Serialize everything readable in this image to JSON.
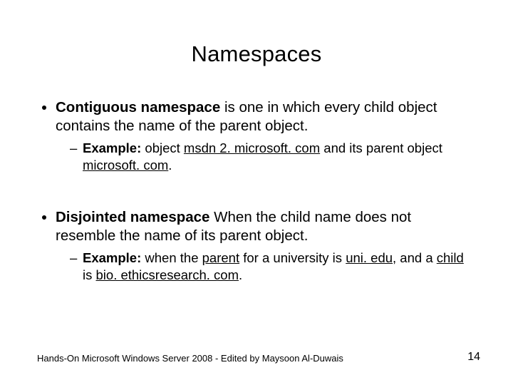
{
  "title": "Namespaces",
  "topic1": {
    "label": "Contiguous namespace",
    "rest": " is one in which every child object contains the name of the parent object.",
    "example_label": "Example:",
    "example_prefix": "   object ",
    "example_link1": "msdn 2. microsoft. com",
    "example_mid": " and its parent object ",
    "example_link2": "microsoft. com",
    "example_end": "."
  },
  "topic2": {
    "label": "Disjointed namespace",
    "rest": " When the child name does not resemble the name of its parent object.",
    "example_label": "Example:",
    "example_prefix": " when the ",
    "parent_word": "parent",
    "mid1": " for a university is ",
    "uni": "uni. edu",
    "mid2": ", and a ",
    "child_word": "child",
    "mid3": " is ",
    "bio": "bio. ethicsresearch. com",
    "end": "."
  },
  "footer_left": "Hands-On Microsoft Windows Server 2008 - Edited by Maysoon Al-Duwais",
  "page_number": "14"
}
